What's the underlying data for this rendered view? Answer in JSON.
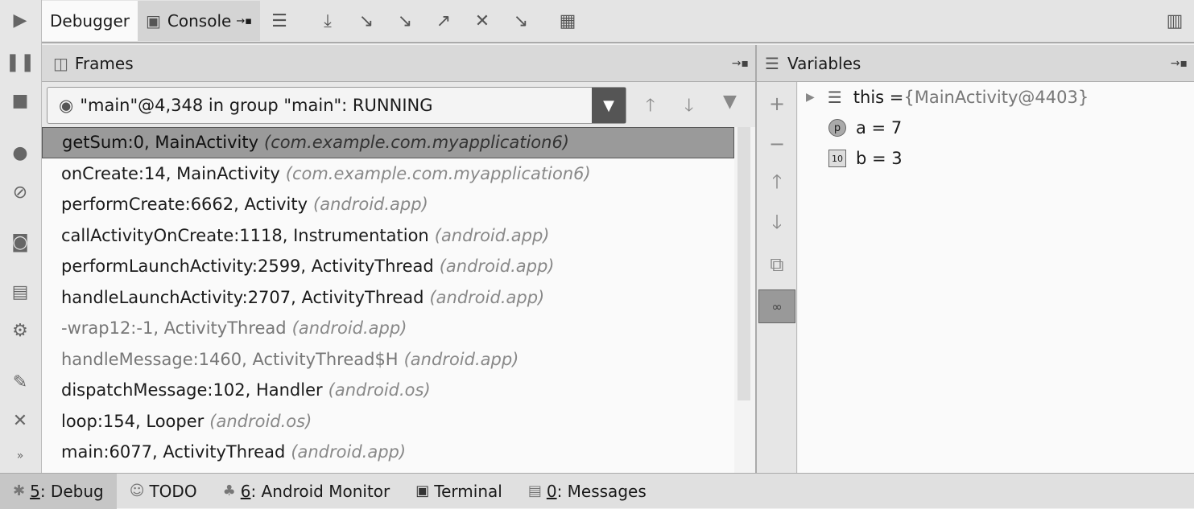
{
  "toolbar": {
    "tabs": [
      {
        "label": "Debugger"
      },
      {
        "label": "Console"
      }
    ],
    "icons": [
      "show-execution-point-icon",
      "step-over-icon",
      "step-into-icon",
      "force-step-into-icon",
      "step-out-icon",
      "drop-frame-icon",
      "run-to-cursor-icon",
      "evaluate-expression-icon",
      "restore-layout-icon"
    ]
  },
  "frames": {
    "title": "Frames",
    "thread": "\"main\"@4,348 in group \"main\": RUNNING",
    "items": [
      {
        "method": "getSum:0, MainActivity",
        "pkg": "(com.example.com.myapplication6)"
      },
      {
        "method": "onCreate:14, MainActivity",
        "pkg": "(com.example.com.myapplication6)"
      },
      {
        "method": "performCreate:6662, Activity",
        "pkg": "(android.app)"
      },
      {
        "method": "callActivityOnCreate:1118, Instrumentation",
        "pkg": "(android.app)"
      },
      {
        "method": "performLaunchActivity:2599, ActivityThread",
        "pkg": "(android.app)"
      },
      {
        "method": "handleLaunchActivity:2707, ActivityThread",
        "pkg": "(android.app)"
      },
      {
        "method": "-wrap12:-1, ActivityThread",
        "pkg": "(android.app)"
      },
      {
        "method": "handleMessage:1460, ActivityThread$H",
        "pkg": "(android.app)"
      },
      {
        "method": "dispatchMessage:102, Handler",
        "pkg": "(android.os)"
      },
      {
        "method": "loop:154, Looper",
        "pkg": "(android.os)"
      },
      {
        "method": "main:6077, ActivityThread",
        "pkg": "(android.app)"
      }
    ]
  },
  "variables": {
    "title": "Variables",
    "items": [
      {
        "name": "this = ",
        "value": "{MainActivity@4403}"
      },
      {
        "name": "a = 7",
        "value": ""
      },
      {
        "name": "b = 3",
        "value": ""
      }
    ]
  },
  "bottom": {
    "tabs": [
      {
        "key": "5",
        "label": ": Debug"
      },
      {
        "key": "",
        "label": "TODO"
      },
      {
        "key": "6",
        "label": ": Android Monitor"
      },
      {
        "key": "",
        "label": "Terminal"
      },
      {
        "key": "0",
        "label": ": Messages"
      }
    ]
  }
}
